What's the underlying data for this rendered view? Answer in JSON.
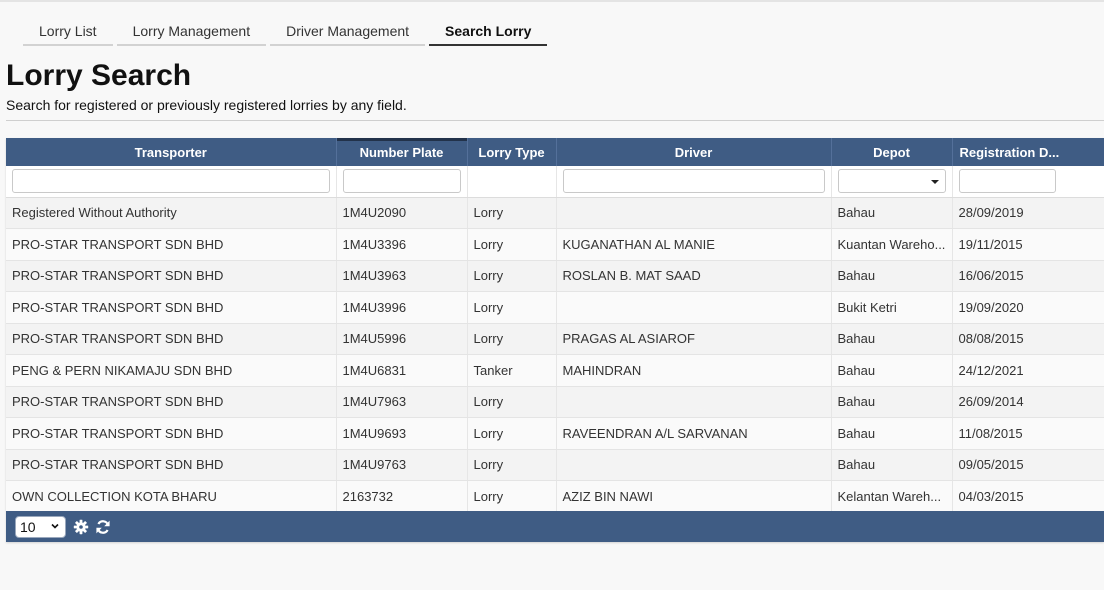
{
  "tabs": [
    {
      "label": "Lorry List"
    },
    {
      "label": "Lorry Management"
    },
    {
      "label": "Driver Management"
    },
    {
      "label": "Search Lorry",
      "active": true
    }
  ],
  "page": {
    "title": "Lorry Search",
    "subtitle": "Search for registered or previously registered lorries by any field."
  },
  "grid": {
    "columns": [
      "Transporter",
      "Number Plate",
      "Lorry Type",
      "Driver",
      "Depot",
      "Registration D..."
    ],
    "rows": [
      [
        "Registered Without Authority",
        "1M4U2090",
        "Lorry",
        "",
        "Bahau",
        "28/09/2019"
      ],
      [
        "PRO-STAR TRANSPORT SDN BHD",
        "1M4U3396",
        "Lorry",
        "KUGANATHAN AL MANIE",
        "Kuantan Wareho...",
        "19/11/2015"
      ],
      [
        "PRO-STAR TRANSPORT SDN BHD",
        "1M4U3963",
        "Lorry",
        "ROSLAN B. MAT SAAD",
        "Bahau",
        "16/06/2015"
      ],
      [
        "PRO-STAR TRANSPORT SDN BHD",
        "1M4U3996",
        "Lorry",
        "",
        "Bukit Ketri",
        "19/09/2020"
      ],
      [
        "PRO-STAR TRANSPORT SDN BHD",
        "1M4U5996",
        "Lorry",
        "PRAGAS AL ASIAROF",
        "Bahau",
        "08/08/2015"
      ],
      [
        "PENG & PERN NIKAMAJU SDN BHD",
        "1M4U6831",
        "Tanker",
        "MAHINDRAN",
        "Bahau",
        "24/12/2021"
      ],
      [
        "PRO-STAR TRANSPORT SDN BHD",
        "1M4U7963",
        "Lorry",
        "",
        "Bahau",
        "26/09/2014"
      ],
      [
        "PRO-STAR TRANSPORT SDN BHD",
        "1M4U9693",
        "Lorry",
        "RAVEENDRAN A/L SARVANAN",
        "Bahau",
        "11/08/2015"
      ],
      [
        "PRO-STAR TRANSPORT SDN BHD",
        "1M4U9763",
        "Lorry",
        "",
        "Bahau",
        "09/05/2015"
      ],
      [
        "OWN COLLECTION KOTA BHARU",
        "2163732",
        "Lorry",
        "AZIZ BIN NAWI",
        "Kelantan Wareh...",
        "04/03/2015"
      ]
    ],
    "page_size": "10",
    "icons": [
      "gear-icon",
      "refresh-icon"
    ]
  },
  "colors": {
    "header": "#3f5c84",
    "background": "#f8f8f8"
  }
}
